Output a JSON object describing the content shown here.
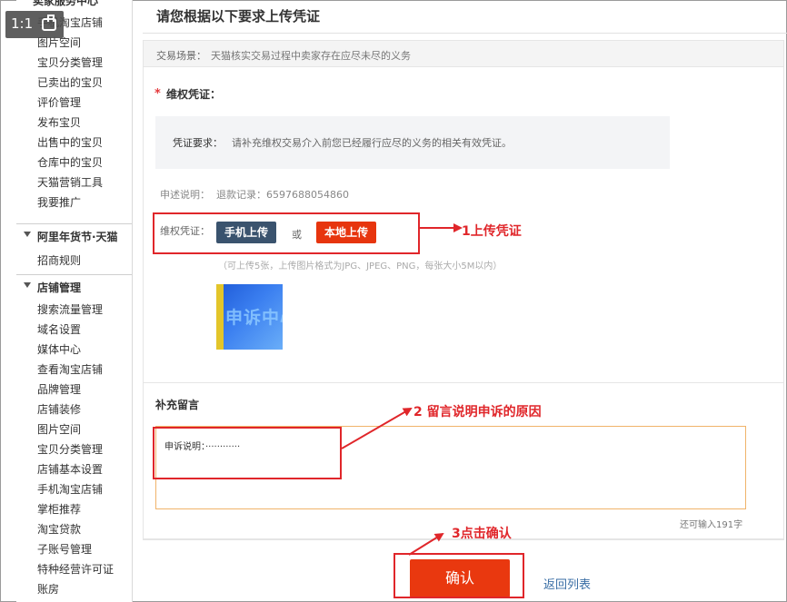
{
  "zoom": {
    "level": "1:1"
  },
  "sidebar": {
    "top_cut": "卖家服务中心",
    "group1_items": [
      "手机淘宝店铺",
      "图片空间",
      "宝贝分类管理",
      "已卖出的宝贝",
      "评价管理",
      "发布宝贝",
      "出售中的宝贝",
      "仓库中的宝贝",
      "天猫营销工具",
      "我要推广"
    ],
    "section2": {
      "title": "阿里年货节·天猫",
      "items": [
        "招商规则"
      ]
    },
    "section3": {
      "title": "店铺管理",
      "items": [
        "搜索流量管理",
        "域名设置",
        "媒体中心",
        "查看淘宝店铺",
        "品牌管理",
        "店铺装修",
        "图片空间",
        "宝贝分类管理",
        "店铺基本设置",
        "手机淘宝店铺",
        "掌柜推荐",
        "淘宝贷款",
        "子账号管理",
        "特种经营许可证",
        "账房"
      ]
    }
  },
  "dialog": {
    "title": "请您根据以下要求上传凭证",
    "scene_label": "交易场景：",
    "scene_value": "天猫核实交易过程中卖家存在应尽未尽的义务",
    "evidence_star": "*",
    "evidence_label": "维权凭证：",
    "requirement_label": "凭证要求：",
    "requirement_value": "请补充维权交易介入前您已经履行应尽的义务的相关有效凭证。",
    "desc_label": "申述说明：",
    "desc_value": "退款记录：6597688054860",
    "upload_label": "维权凭证：",
    "phone_upload": "手机上传",
    "or": "或",
    "local_upload": "本地上传",
    "upload_hint": "（可上传5张，上传图片格式为JPG、JPEG、PNG，每张大小5M以内）",
    "thumbnail_text": "申诉中心",
    "note_label": "补充留言",
    "note_text": "申诉说明：············",
    "remaining": "还可输入191字",
    "confirm": "确认",
    "back": "返回列表"
  },
  "annotations": {
    "step1": "1上传凭证",
    "step2": "2 留言说明申诉的原因",
    "step3": "3点击确认"
  },
  "colors": {
    "accent_red": "#e7350e",
    "annotation_red": "#e0262a",
    "phone_button": "#3a536e",
    "link_blue": "#3a6ea5"
  }
}
